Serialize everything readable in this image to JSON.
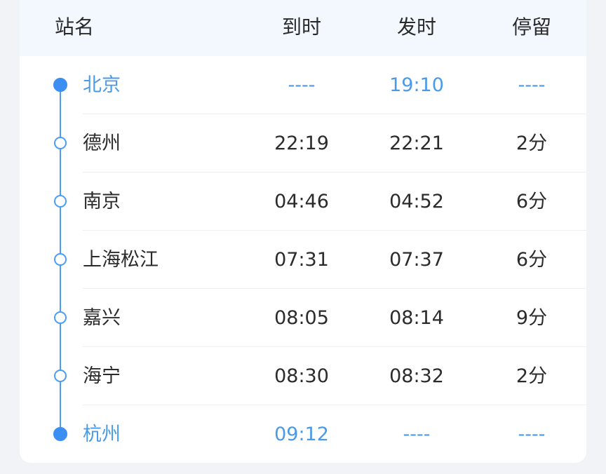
{
  "header": {
    "station": "站名",
    "arrive": "到时",
    "depart": "发时",
    "stay": "停留"
  },
  "colors": {
    "accent": "#4c9cf5",
    "header_bg": "#f3f8fe",
    "text": "#2b2b2b"
  },
  "stops": [
    {
      "name": "北京",
      "arrive": "----",
      "depart": "19:10",
      "stay": "----",
      "endpoint": true
    },
    {
      "name": "德州",
      "arrive": "22:19",
      "depart": "22:21",
      "stay": "2分",
      "endpoint": false
    },
    {
      "name": "南京",
      "arrive": "04:46",
      "depart": "04:52",
      "stay": "6分",
      "endpoint": false
    },
    {
      "name": "上海松江",
      "arrive": "07:31",
      "depart": "07:37",
      "stay": "6分",
      "endpoint": false
    },
    {
      "name": "嘉兴",
      "arrive": "08:05",
      "depart": "08:14",
      "stay": "9分",
      "endpoint": false
    },
    {
      "name": "海宁",
      "arrive": "08:30",
      "depart": "08:32",
      "stay": "2分",
      "endpoint": false
    },
    {
      "name": "杭州",
      "arrive": "09:12",
      "depart": "----",
      "stay": "----",
      "endpoint": true
    }
  ]
}
